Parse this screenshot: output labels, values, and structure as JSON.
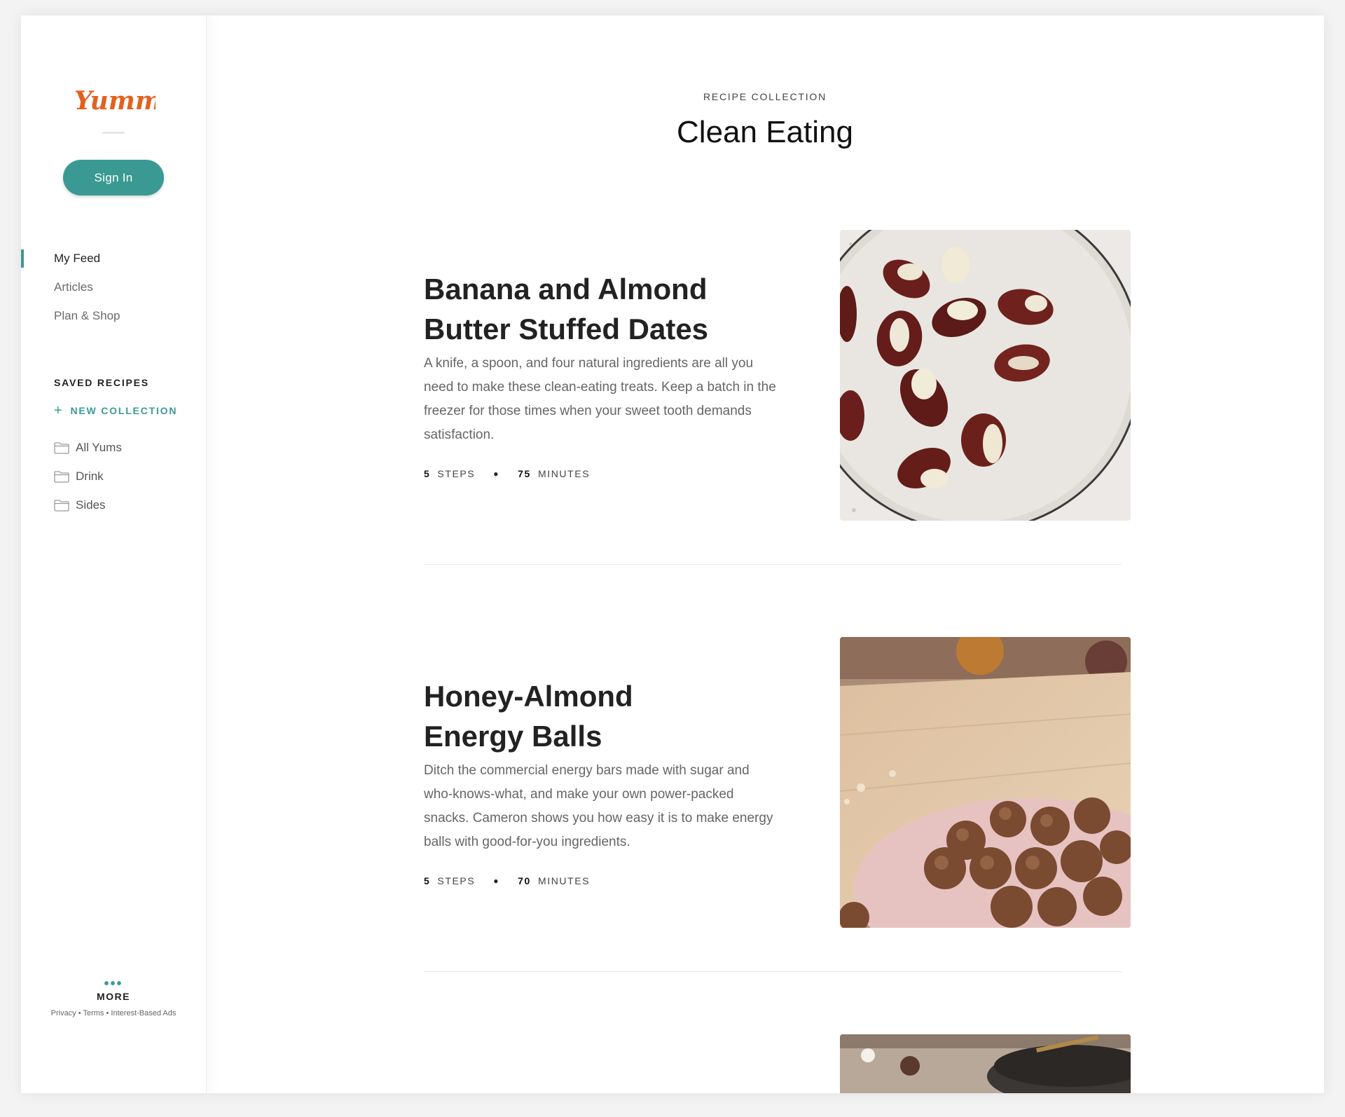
{
  "brand": {
    "name": "Yummly",
    "color": "#e16120"
  },
  "accent_color": "#3a9a93",
  "sidebar": {
    "sign_in_label": "Sign In",
    "nav": [
      {
        "label": "My Feed",
        "active": true
      },
      {
        "label": "Articles",
        "active": false
      },
      {
        "label": "Plan & Shop",
        "active": false
      }
    ],
    "saved_recipes_title": "SAVED RECIPES",
    "new_collection_label": "NEW COLLECTION",
    "folders": [
      {
        "label": "All Yums",
        "icon": "folder-icon"
      },
      {
        "label": "Drink",
        "icon": "folder-icon"
      },
      {
        "label": "Sides",
        "icon": "folder-icon"
      }
    ],
    "more_label": "MORE",
    "footer": {
      "privacy": "Privacy",
      "terms": "Terms",
      "ads": "Interest-Based Ads",
      "separator": "•"
    }
  },
  "main": {
    "eyebrow": "RECIPE COLLECTION",
    "title": "Clean Eating",
    "recipes": [
      {
        "title_line1": "Banana and Almond",
        "title_line2": "Butter Stuffed Dates",
        "description": "A knife, a spoon, and four natural ingredients are all you need to make these clean-eating treats. Keep a batch in the freezer for those times when your sweet tooth demands satisfaction.",
        "steps": "5",
        "steps_label": "STEPS",
        "minutes": "75",
        "minutes_label": "MINUTES",
        "image": "stuffed-dates-photo"
      },
      {
        "title_line1": "Honey-Almond",
        "title_line2": "Energy Balls",
        "description": "Ditch the commercial energy bars made with sugar and who-knows-what, and make your own power-packed snacks. Cameron shows you how easy it is to make energy balls with good-for-you ingredients.",
        "steps": "5",
        "steps_label": "STEPS",
        "minutes": "70",
        "minutes_label": "MINUTES",
        "image": "energy-balls-photo"
      },
      {
        "image": "plates-photo"
      }
    ]
  }
}
